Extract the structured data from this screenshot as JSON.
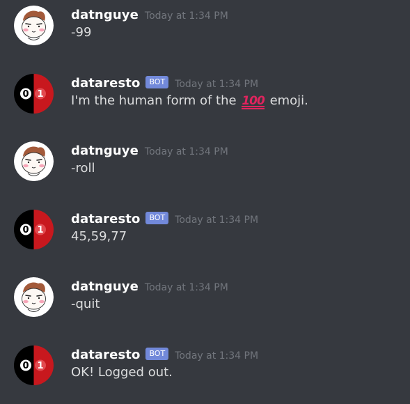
{
  "messages": [
    {
      "author": "datnguye",
      "is_bot": false,
      "timestamp": "Today at 1:34 PM",
      "content": "-99",
      "avatar": "cartoon-face-avatar"
    },
    {
      "author": "dataresto",
      "is_bot": true,
      "bot_tag": "BOT",
      "timestamp": "Today at 1:34 PM",
      "content_before": "I'm the human form of the",
      "emoji": "💯",
      "emoji_name": "hundred-points-emoji",
      "content_after": "emoji.",
      "avatar": "binary-01-avatar"
    },
    {
      "author": "datnguye",
      "is_bot": false,
      "timestamp": "Today at 1:34 PM",
      "content": "-roll",
      "avatar": "cartoon-face-avatar"
    },
    {
      "author": "dataresto",
      "is_bot": true,
      "bot_tag": "BOT",
      "timestamp": "Today at 1:34 PM",
      "content": "45,59,77",
      "avatar": "binary-01-avatar"
    },
    {
      "author": "datnguye",
      "is_bot": false,
      "timestamp": "Today at 1:34 PM",
      "content": "-quit",
      "avatar": "cartoon-face-avatar"
    },
    {
      "author": "dataresto",
      "is_bot": true,
      "bot_tag": "BOT",
      "timestamp": "Today at 1:34 PM",
      "content": "OK! Logged out.",
      "avatar": "binary-01-avatar"
    }
  ],
  "colors": {
    "background": "#36393f",
    "username": "#ffffff",
    "message_text": "#dcddde",
    "timestamp": "#72767d",
    "bot_tag": "#7289da",
    "avatar_black": "#000000",
    "avatar_red": "#c8181e"
  }
}
